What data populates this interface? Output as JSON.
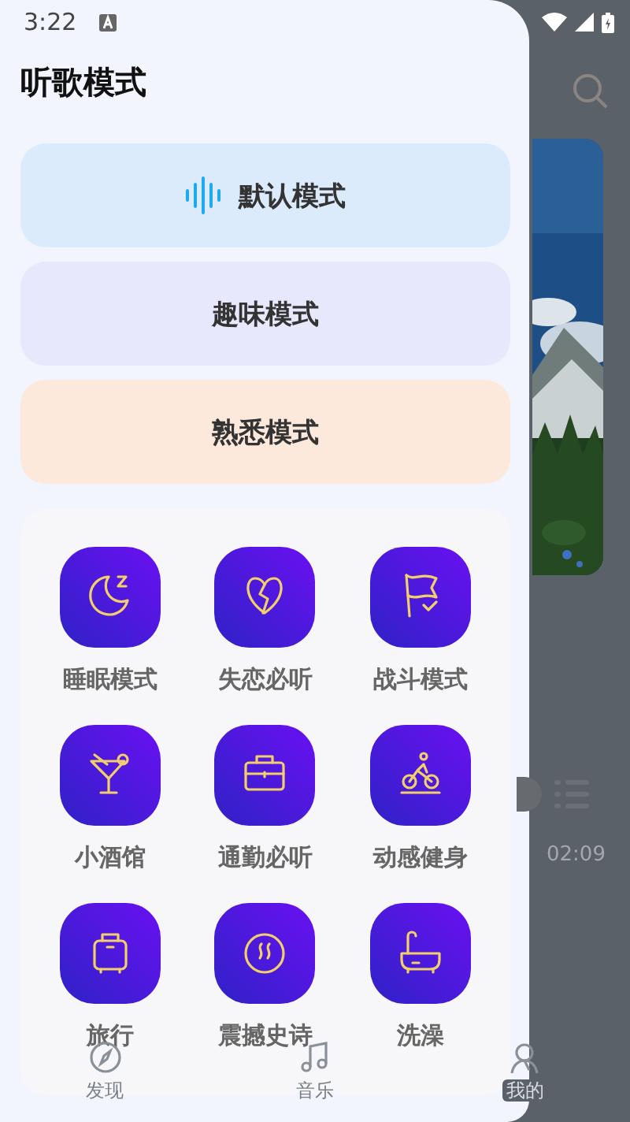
{
  "status_bar": {
    "time": "3:22"
  },
  "drawer": {
    "title": "听歌模式",
    "modes": [
      {
        "label": "默认模式",
        "selected": true,
        "color": "#dcebfc"
      },
      {
        "label": "趣味模式",
        "selected": false,
        "color": "#e8e8fd"
      },
      {
        "label": "熟悉模式",
        "selected": false,
        "color": "#fde9dc"
      }
    ],
    "scenes": [
      {
        "label": "睡眠模式"
      },
      {
        "label": "失恋必听"
      },
      {
        "label": "战斗模式"
      },
      {
        "label": "小酒馆"
      },
      {
        "label": "通勤必听"
      },
      {
        "label": "动感健身"
      },
      {
        "label": "旅行"
      },
      {
        "label": "震撼史诗"
      },
      {
        "label": "洗澡"
      }
    ]
  },
  "player": {
    "duration": "02:09"
  },
  "bottom_nav": [
    {
      "label": "发现"
    },
    {
      "label": "音乐"
    },
    {
      "label": "我的"
    }
  ]
}
